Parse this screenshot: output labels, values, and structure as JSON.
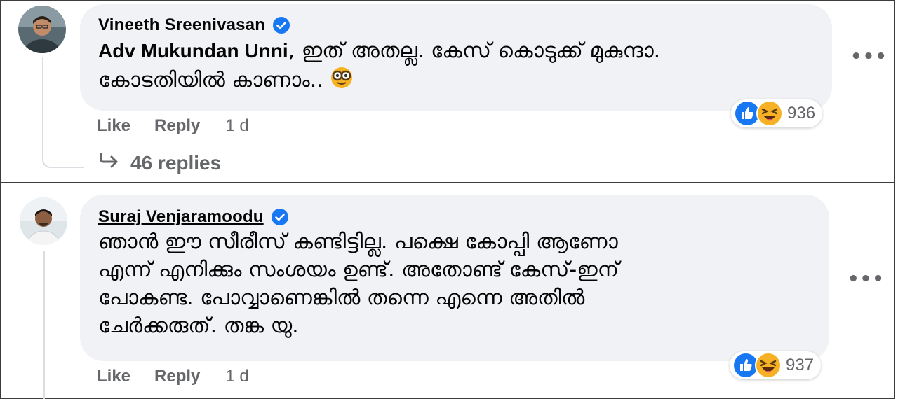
{
  "comments": [
    {
      "author": "Vineeth Sreenivasan",
      "mention": "Adv Mukundan Unni",
      "lines": [
        ", ഇത് അതല്ല. കേസ് കൊടുക്ക് മുകുന്ദാ.",
        "കോടതിയിൽ കാണാം.."
      ],
      "actions": {
        "like": "Like",
        "reply": "Reply",
        "time": "1 d"
      },
      "reaction_count": "936",
      "replies_label": "46 replies"
    },
    {
      "author": "Suraj Venjaramoodu",
      "lines": [
        "ഞാൻ ഈ സീരീസ് കണ്ടിട്ടില്ല. പക്ഷെ കോപ്പി ആണോ",
        "എന്ന് എനിക്കും സംശയം ഉണ്ട്. അതോണ്ട് കേസ്-ഇന്",
        "പോകണ്ട. പോവ്വാണെങ്കിൽ തന്നെ എന്നെ അതിൽ",
        "ചേർക്കരുത്. തങ്ക യു."
      ],
      "actions": {
        "like": "Like",
        "reply": "Reply",
        "time": "1 d"
      },
      "reaction_count": "937"
    }
  ],
  "more_label": "•••",
  "icons": {
    "verified": "verified-badge-icon",
    "like": "like-reaction-icon",
    "haha": "haha-reaction-icon",
    "nerd": "nerd-face-emoji-icon",
    "reply_arrow": "reply-arrow-icon"
  },
  "colors": {
    "bubble": "#f0f2f5",
    "meta": "#65676b",
    "verified": "#1877f2",
    "like": "#1877f2",
    "haha": "#f7b125"
  }
}
